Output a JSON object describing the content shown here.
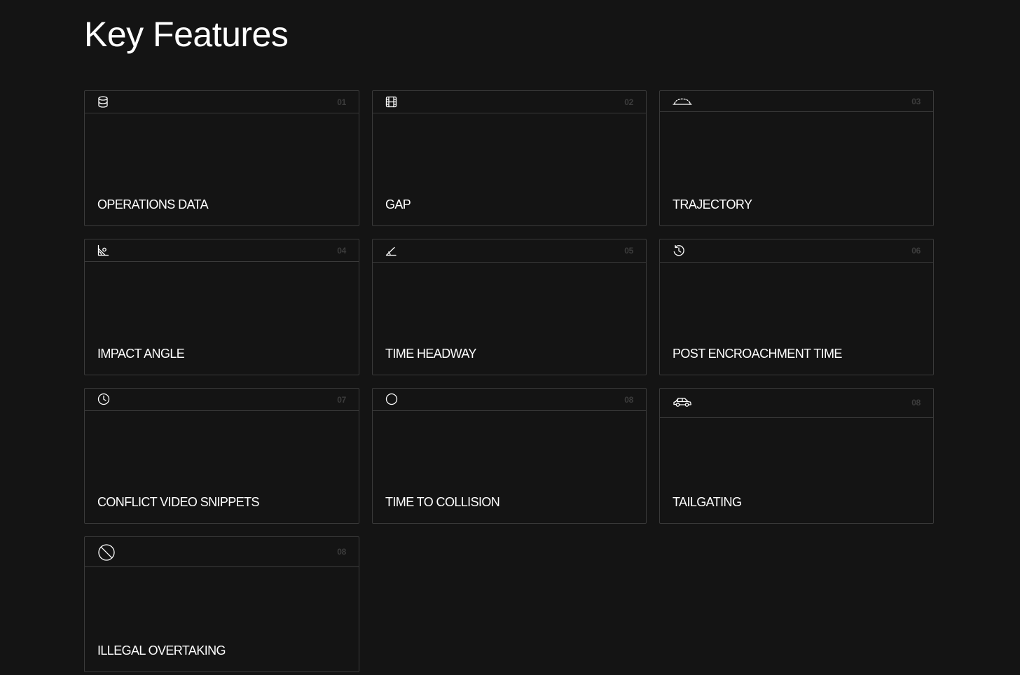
{
  "page": {
    "heading": "Key Features"
  },
  "features": [
    {
      "number": "01",
      "title": "OPERATIONS DATA",
      "icon": "database-icon"
    },
    {
      "number": "02",
      "title": "GAP",
      "icon": "film-icon"
    },
    {
      "number": "03",
      "title": "TRAJECTORY",
      "icon": "arc-icon"
    },
    {
      "number": "04",
      "title": "IMPACT ANGLE",
      "icon": "angle-ruler-icon"
    },
    {
      "number": "05",
      "title": "TIME HEADWAY",
      "icon": "angle-icon"
    },
    {
      "number": "06",
      "title": "POST ENCROACHMENT TIME",
      "icon": "clock-history-icon"
    },
    {
      "number": "07",
      "title": "CONFLICT VIDEO SNIPPETS",
      "icon": "clock-icon"
    },
    {
      "number": "08",
      "title": "TIME TO COLLISION",
      "icon": "circle-icon"
    },
    {
      "number": "08",
      "title": "TAILGATING",
      "icon": "car-icon"
    },
    {
      "number": "08",
      "title": "ILLEGAL OVERTAKING",
      "icon": "prohibited-icon"
    }
  ],
  "colors": {
    "background": "#141414",
    "border": "#3a3a3a",
    "text": "#ffffff",
    "number": "#3c3c3c"
  }
}
